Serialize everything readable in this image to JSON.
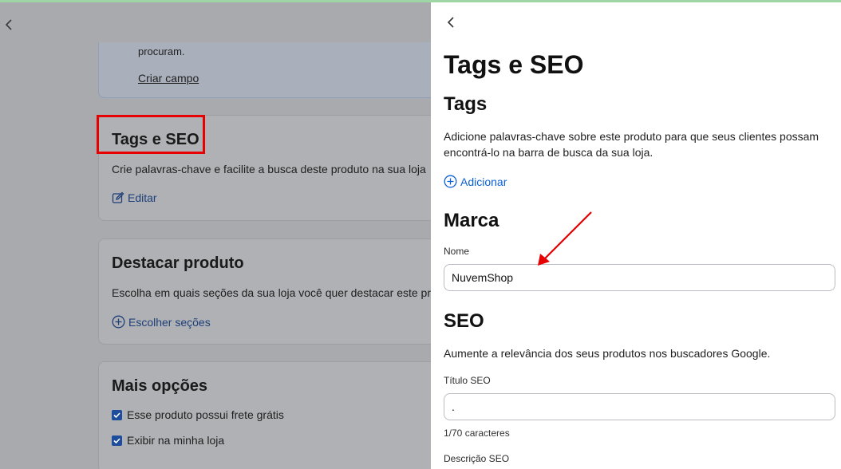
{
  "background": {
    "info_card": {
      "text": "procuram.",
      "link": "Criar campo"
    },
    "tags_card": {
      "title": "Tags e SEO",
      "description": "Crie palavras-chave e facilite a busca deste produto na sua loja",
      "action": "Editar"
    },
    "highlight_card": {
      "title": "Destacar produto",
      "description": "Escolha em quais seções da sua loja você quer destacar este produto",
      "action": "Escolher seções"
    },
    "more_card": {
      "title": "Mais opções",
      "options": [
        "Esse produto possui frete grátis",
        "Exibir na minha loja"
      ]
    }
  },
  "panel": {
    "title": "Tags e SEO",
    "tags": {
      "heading": "Tags",
      "description": "Adicione palavras-chave sobre este produto para que seus clientes possam encontrá-lo na barra de busca da sua loja.",
      "add_label": "Adicionar"
    },
    "brand": {
      "heading": "Marca",
      "name_label": "Nome",
      "name_value": "NuvemShop"
    },
    "seo": {
      "heading": "SEO",
      "description": "Aumente a relevância dos seus produtos nos buscadores Google.",
      "title_label": "Título SEO",
      "title_value": ".",
      "title_counter": "1/70 caracteres",
      "description_label": "Descrição SEO"
    }
  },
  "colors": {
    "accent_link": "#0b5fd6",
    "annotation_red": "#e60000"
  }
}
